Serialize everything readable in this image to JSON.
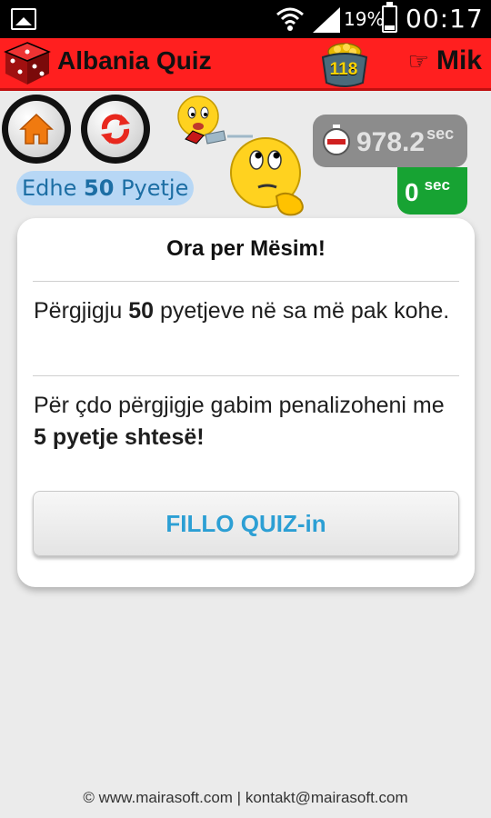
{
  "status_bar": {
    "battery": "19%",
    "time": "00:17"
  },
  "header": {
    "title": "Albania Quiz",
    "coins": "118",
    "user": "Mik"
  },
  "quiz_info": {
    "remaining_prefix": "Edhe",
    "remaining_count": "50",
    "remaining_suffix": "Pyetje",
    "timer_value": "978.2",
    "timer_unit": "sec",
    "penalty_value": "0",
    "penalty_unit": "sec"
  },
  "card": {
    "title": "Ora per Mësim!",
    "line1_prefix": "Përgjigju",
    "line1_bold": "50",
    "line1_suffix": "pyetjeve në sa më pak kohe.",
    "line2_prefix": "Për çdo përgjigje gabim penalizoheni me",
    "line2_bold": "5 pyetje shtesë!",
    "start_button": "FILLO QUIZ-in"
  },
  "footer": {
    "text": "© www.mairasoft.com | kontakt@mairasoft.com"
  },
  "colors": {
    "header": "#ff1f1f",
    "accent_blue": "#2c9fd4",
    "timer_bg": "#8c8c8c",
    "penalty_bg": "#17a333"
  }
}
